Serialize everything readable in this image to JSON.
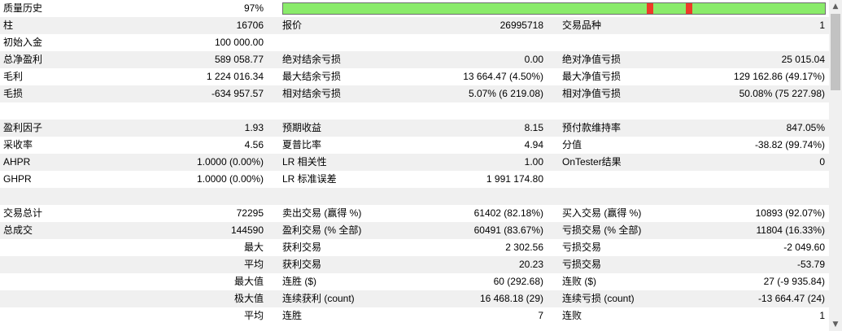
{
  "history_quality": {
    "label": "质量历史",
    "value": "97%",
    "fraction": 0.97
  },
  "colors": {
    "quality_bar_fill": "#8aeb6a",
    "quality_bar_error": "#ee3a28",
    "shaded_row": "#f0f0f0"
  },
  "rows": [
    {
      "cells": [
        "柱",
        "16706",
        "报价",
        "26995718",
        "交易品种",
        "1"
      ]
    },
    {
      "cells": [
        "初始入金",
        "100 000.00",
        "",
        "",
        "",
        ""
      ]
    },
    {
      "cells": [
        "总净盈利",
        "589 058.77",
        "绝对结余亏损",
        "0.00",
        "绝对净值亏损",
        "25 015.04"
      ]
    },
    {
      "cells": [
        "毛利",
        "1 224 016.34",
        "最大结余亏损",
        "13 664.47 (4.50%)",
        "最大净值亏损",
        "129 162.86 (49.17%)"
      ]
    },
    {
      "cells": [
        "毛损",
        "-634 957.57",
        "相对结余亏损",
        "5.07% (6 219.08)",
        "相对净值亏损",
        "50.08% (75 227.98)"
      ]
    },
    {
      "cells": [
        "",
        "",
        "",
        "",
        "",
        ""
      ]
    },
    {
      "cells": [
        "盈利因子",
        "1.93",
        "预期收益",
        "8.15",
        "预付款维持率",
        "847.05%"
      ]
    },
    {
      "cells": [
        "采收率",
        "4.56",
        "夏普比率",
        "4.94",
        "分值",
        "-38.82 (99.74%)"
      ]
    },
    {
      "cells": [
        "AHPR",
        "1.0000 (0.00%)",
        "LR 相关性",
        "1.00",
        "OnTester结果",
        "0"
      ]
    },
    {
      "cells": [
        "GHPR",
        "1.0000 (0.00%)",
        "LR 标准误差",
        "1 991 174.80",
        "",
        ""
      ]
    },
    {
      "cells": [
        "",
        "",
        "",
        "",
        "",
        ""
      ]
    },
    {
      "cells": [
        "交易总计",
        "72295",
        "卖出交易 (赢得 %)",
        "61402 (82.18%)",
        "买入交易 (赢得 %)",
        "10893 (92.07%)"
      ]
    },
    {
      "cells": [
        "总成交",
        "144590",
        "盈利交易 (% 全部)",
        "60491 (83.67%)",
        "亏损交易 (% 全部)",
        "11804 (16.33%)"
      ]
    },
    {
      "cells": [
        "最大",
        "",
        "获利交易",
        "2 302.56",
        "亏损交易",
        "-2 049.60"
      ]
    },
    {
      "cells": [
        "平均",
        "",
        "获利交易",
        "20.23",
        "亏损交易",
        "-53.79"
      ]
    },
    {
      "cells": [
        "最大值",
        "",
        "连胜 ($)",
        "60 (292.68)",
        "连败 ($)",
        "27 (-9 935.84)"
      ]
    },
    {
      "cells": [
        "极大值",
        "",
        "连续获利 (count)",
        "16 468.18 (29)",
        "连续亏损 (count)",
        "-13 664.47 (24)"
      ]
    },
    {
      "cells": [
        "平均",
        "",
        "连胜",
        "7",
        "连败",
        "1"
      ]
    }
  ]
}
